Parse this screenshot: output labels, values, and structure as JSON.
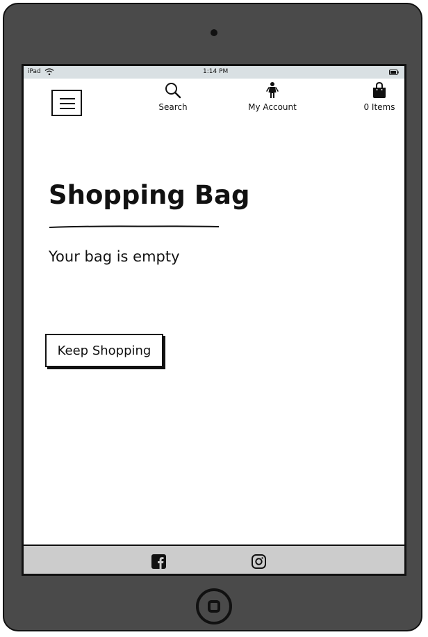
{
  "status_bar": {
    "device": "iPad",
    "time": "1:14 PM",
    "icons": [
      "wifi-icon",
      "battery-icon"
    ]
  },
  "header": {
    "menu_icon": "hamburger-menu-icon",
    "nav": [
      {
        "label": "Search",
        "icon": "search-icon"
      },
      {
        "label": "My Account",
        "icon": "person-icon"
      },
      {
        "label": "0 Items",
        "icon": "shopping-bag-icon"
      }
    ]
  },
  "main": {
    "title": "Shopping Bag",
    "empty_message": "Your bag is empty",
    "keep_shopping_label": "Keep Shopping"
  },
  "footer": {
    "social": [
      {
        "icon": "facebook-icon"
      },
      {
        "icon": "instagram-icon"
      }
    ]
  },
  "colors": {
    "device_frame": "#4a4a4a",
    "status_bar": "#d9e0e3",
    "footer": "#cccccc",
    "text": "#111111"
  }
}
